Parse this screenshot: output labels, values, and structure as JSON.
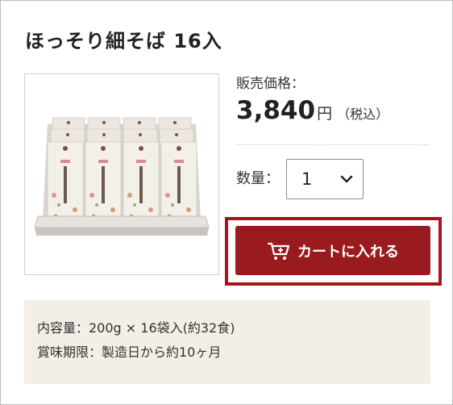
{
  "product": {
    "title": "ほっそり細そば 16入",
    "image_alt": "ほっそり細そば"
  },
  "price": {
    "label": "販売価格：",
    "value": "3,840",
    "unit": "円",
    "tax_note": "（税込）"
  },
  "quantity": {
    "label": "数量：",
    "selected": "1"
  },
  "cart": {
    "button_label": "カートに入れる",
    "icon": "cart-add-icon"
  },
  "details": {
    "contents": "内容量：200g × 16袋入(約32食)",
    "shelf_life": "賞味期限：製造日から約10ヶ月"
  },
  "colors": {
    "accent": "#9a1b1f",
    "highlight_border": "#a8141d",
    "info_background": "#f4efe6"
  }
}
